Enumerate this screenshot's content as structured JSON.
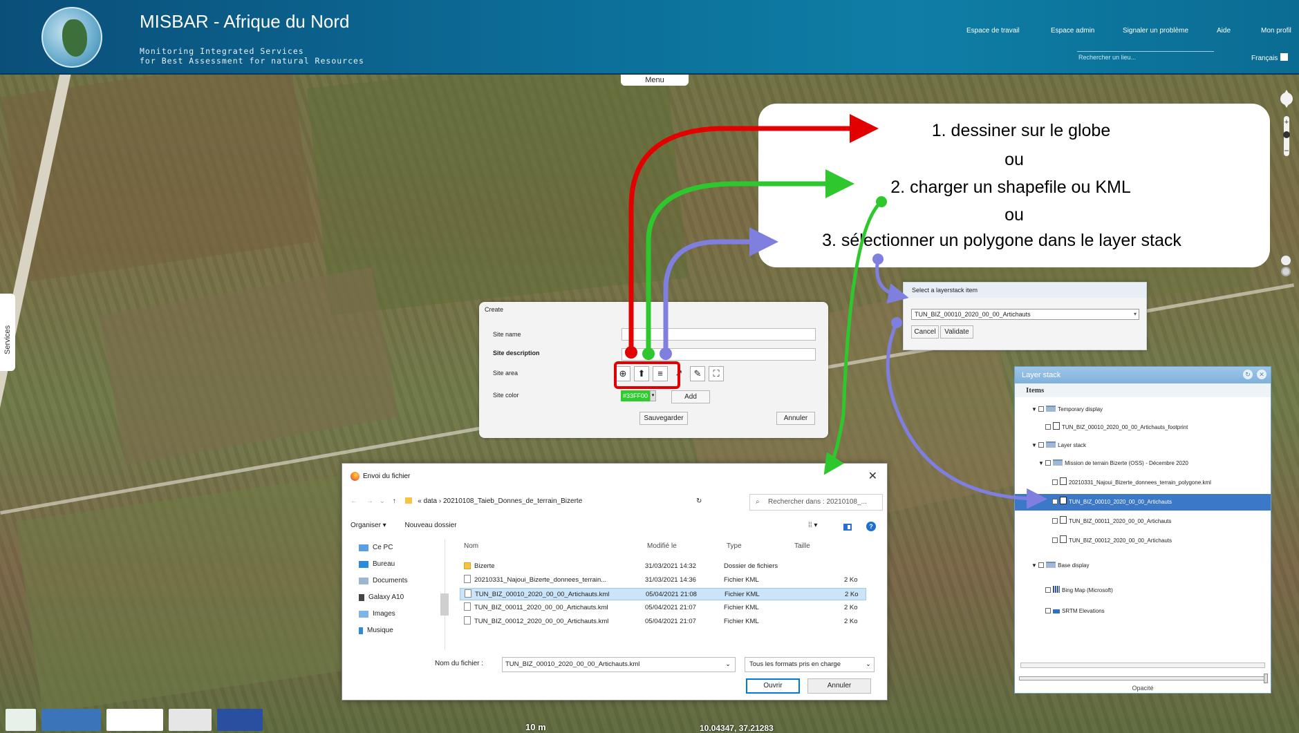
{
  "header": {
    "title": "MISBAR - Afrique du Nord",
    "subtitle_line1": "Monitoring Integrated Services",
    "subtitle_line2": "for Best Assessment for natural Resources",
    "nav": [
      "Espace de travail",
      "Espace admin",
      "Signaler un problème",
      "Aide",
      "Mon profil"
    ],
    "search_placeholder": "Rechercher un lieu...",
    "language": "Français"
  },
  "map": {
    "menu_label": "Menu",
    "services_label": "Services",
    "scale_label": "10 m",
    "coordinates": "10.04347, 37.21283"
  },
  "callout": {
    "line1": "1. dessiner sur le globe",
    "or1": "ou",
    "line2": "2. charger un shapefile ou KML",
    "or2": "ou",
    "line3": "3. sélectionner un polygone dans le layer stack"
  },
  "create_dialog": {
    "title": "Create",
    "site_name_label": "Site name",
    "site_description_label": "Site description",
    "site_area_label": "Site area",
    "site_color_label": "Site color",
    "color_value": "#33FF00",
    "add_label": "Add",
    "save_label": "Sauvegarder",
    "cancel_label": "Annuler",
    "tools": [
      "⊕",
      "⬆",
      "≡",
      "↗",
      "✎",
      "⛶"
    ]
  },
  "select_dialog": {
    "title": "Select a layerstack item",
    "selected": "TUN_BIZ_00010_2020_00_00_Artichauts",
    "cancel_label": "Cancel",
    "validate_label": "Validate"
  },
  "file_dialog": {
    "title": "Envoi du fichier",
    "path": "« data › 20210108_Taieb_Donnes_de_terrain_Bizerte",
    "search_placeholder": "Rechercher dans : 20210108_...",
    "organize_label": "Organiser ▾",
    "new_folder_label": "Nouveau dossier",
    "tree": [
      "Ce PC",
      "Bureau",
      "Documents",
      "Galaxy A10",
      "Images",
      "Musique"
    ],
    "columns": [
      "Nom",
      "Modifié le",
      "Type",
      "Taille"
    ],
    "files": [
      {
        "name": "Bizerte",
        "modified": "31/03/2021 14:32",
        "type": "Dossier de fichiers",
        "size": ""
      },
      {
        "name": "20210331_Najoui_Bizerte_donnees_terrain...",
        "modified": "31/03/2021 14:36",
        "type": "Fichier KML",
        "size": "2 Ko"
      },
      {
        "name": "TUN_BIZ_00010_2020_00_00_Artichauts.kml",
        "modified": "05/04/2021 21:08",
        "type": "Fichier KML",
        "size": "2 Ko"
      },
      {
        "name": "TUN_BIZ_00011_2020_00_00_Artichauts.kml",
        "modified": "05/04/2021 21:07",
        "type": "Fichier KML",
        "size": "2 Ko"
      },
      {
        "name": "TUN_BIZ_00012_2020_00_00_Artichauts.kml",
        "modified": "05/04/2021 21:07",
        "type": "Fichier KML",
        "size": "2 Ko"
      }
    ],
    "filename_label": "Nom du fichier :",
    "filename_value": "TUN_BIZ_00010_2020_00_00_Artichauts.kml",
    "filter_value": "Tous les formats pris en charge",
    "open_label": "Ouvrir",
    "cancel_label": "Annuler"
  },
  "layer_stack": {
    "title": "Layer stack",
    "items_header": "Items",
    "rows": [
      "Temporary display",
      "TUN_BIZ_00010_2020_00_00_Artichauts_footprint",
      "Layer stack",
      "Mission de terrain Bizerte (OSS) - Décembre 2020",
      "20210331_Najoui_Bizerte_donnees_terrain_polygone.kml",
      "TUN_BIZ_00010_2020_00_00_Artichauts",
      "TUN_BIZ_00011_2020_00_00_Artichauts",
      "TUN_BIZ_00012_2020_00_00_Artichauts",
      "Base display",
      "Bing Map (Microsoft)",
      "SRTM Elevations"
    ],
    "opacity_label": "Opacité"
  },
  "colors": {
    "arrow_red": "#e30000",
    "arrow_green": "#2ec82e",
    "arrow_purple": "#7f7fe0",
    "header_blue": "#0c6f99",
    "selection_blue": "#3c78c8"
  }
}
